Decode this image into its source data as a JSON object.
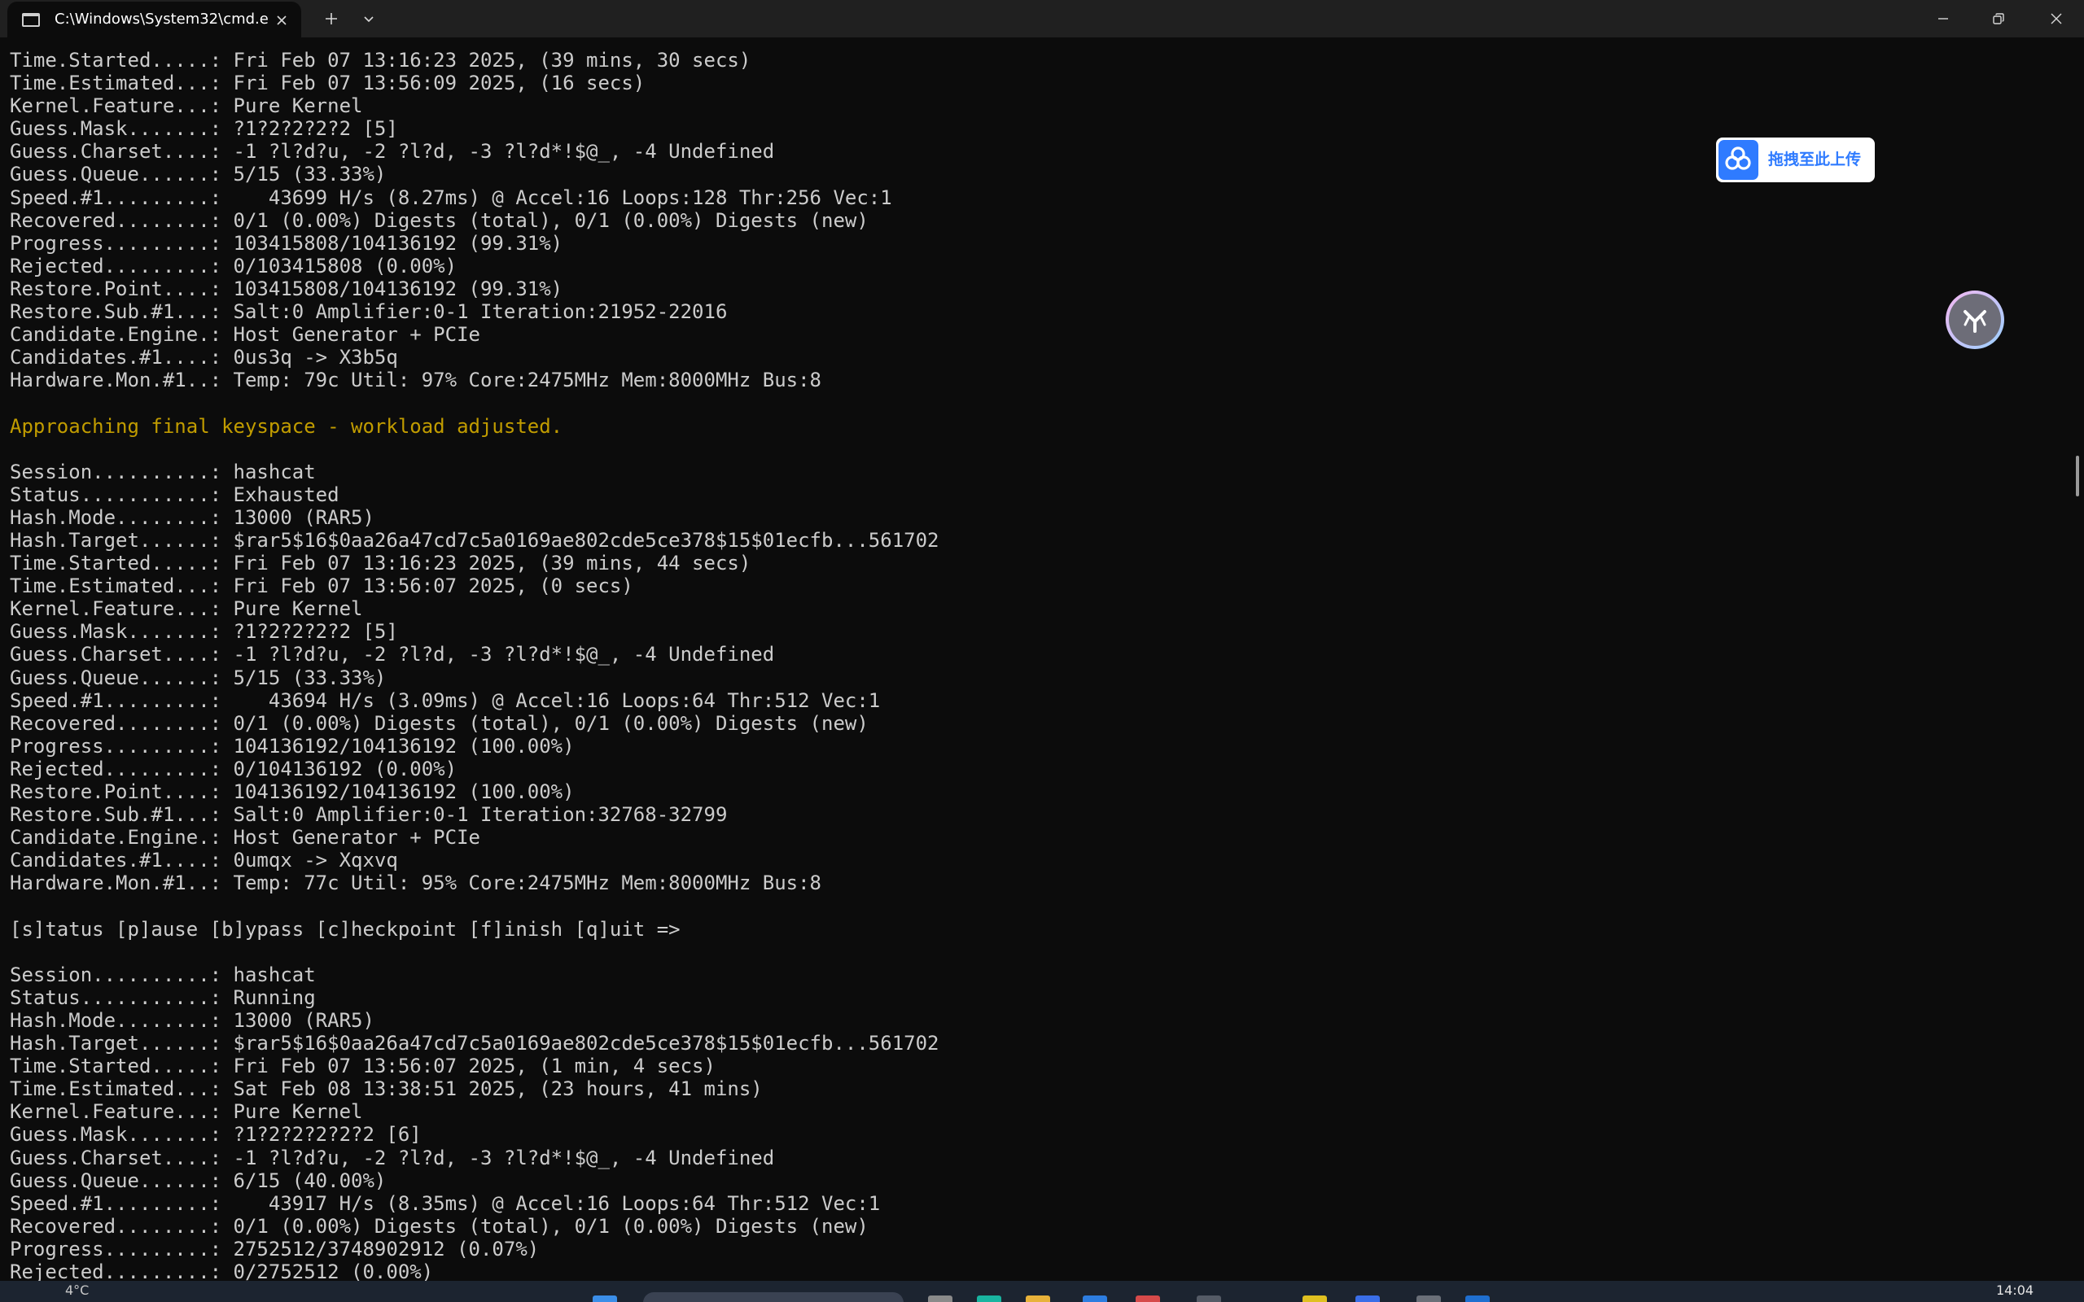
{
  "window": {
    "tab_title": "C:\\Windows\\System32\\cmd.e",
    "icons": {
      "tab": "command-prompt-icon",
      "tab_close": "close-icon",
      "new_tab": "plus-icon",
      "tab_dropdown": "chevron-down-icon",
      "minimize": "minimize-icon",
      "restore": "restore-icon",
      "close": "close-icon"
    }
  },
  "terminal": {
    "colors": {
      "background": "#0c0c0c",
      "text": "#cccccc",
      "warning": "#c19c00"
    },
    "lines": [
      "Time.Started.....: Fri Feb 07 13:16:23 2025, (39 mins, 30 secs)",
      "Time.Estimated...: Fri Feb 07 13:56:09 2025, (16 secs)",
      "Kernel.Feature...: Pure Kernel",
      "Guess.Mask.......: ?1?2?2?2?2 [5]",
      "Guess.Charset....: -1 ?l?d?u, -2 ?l?d, -3 ?l?d*!$@_, -4 Undefined",
      "Guess.Queue......: 5/15 (33.33%)",
      "Speed.#1.........:    43699 H/s (8.27ms) @ Accel:16 Loops:128 Thr:256 Vec:1",
      "Recovered........: 0/1 (0.00%) Digests (total), 0/1 (0.00%) Digests (new)",
      "Progress.........: 103415808/104136192 (99.31%)",
      "Rejected.........: 0/103415808 (0.00%)",
      "Restore.Point....: 103415808/104136192 (99.31%)",
      "Restore.Sub.#1...: Salt:0 Amplifier:0-1 Iteration:21952-22016",
      "Candidate.Engine.: Host Generator + PCIe",
      "Candidates.#1....: 0us3q -> X3b5q",
      "Hardware.Mon.#1..: Temp: 79c Util: 97% Core:2475MHz Mem:8000MHz Bus:8",
      "",
      "Approaching final keyspace - workload adjusted.",
      "",
      "Session..........: hashcat",
      "Status...........: Exhausted",
      "Hash.Mode........: 13000 (RAR5)",
      "Hash.Target......: $rar5$16$0aa26a47cd7c5a0169ae802cde5ce378$15$01ecfb...561702",
      "Time.Started.....: Fri Feb 07 13:16:23 2025, (39 mins, 44 secs)",
      "Time.Estimated...: Fri Feb 07 13:56:07 2025, (0 secs)",
      "Kernel.Feature...: Pure Kernel",
      "Guess.Mask.......: ?1?2?2?2?2 [5]",
      "Guess.Charset....: -1 ?l?d?u, -2 ?l?d, -3 ?l?d*!$@_, -4 Undefined",
      "Guess.Queue......: 5/15 (33.33%)",
      "Speed.#1.........:    43694 H/s (3.09ms) @ Accel:16 Loops:64 Thr:512 Vec:1",
      "Recovered........: 0/1 (0.00%) Digests (total), 0/1 (0.00%) Digests (new)",
      "Progress.........: 104136192/104136192 (100.00%)",
      "Rejected.........: 0/104136192 (0.00%)",
      "Restore.Point....: 104136192/104136192 (100.00%)",
      "Restore.Sub.#1...: Salt:0 Amplifier:0-1 Iteration:32768-32799",
      "Candidate.Engine.: Host Generator + PCIe",
      "Candidates.#1....: 0umqx -> Xqxvq",
      "Hardware.Mon.#1..: Temp: 77c Util: 95% Core:2475MHz Mem:8000MHz Bus:8",
      "",
      "[s]tatus [p]ause [b]ypass [c]heckpoint [f]inish [q]uit =>",
      "",
      "Session..........: hashcat",
      "Status...........: Running",
      "Hash.Mode........: 13000 (RAR5)",
      "Hash.Target......: $rar5$16$0aa26a47cd7c5a0169ae802cde5ce378$15$01ecfb...561702",
      "Time.Started.....: Fri Feb 07 13:56:07 2025, (1 min, 4 secs)",
      "Time.Estimated...: Sat Feb 08 13:38:51 2025, (23 hours, 41 mins)",
      "Kernel.Feature...: Pure Kernel",
      "Guess.Mask.......: ?1?2?2?2?2?2 [6]",
      "Guess.Charset....: -1 ?l?d?u, -2 ?l?d, -3 ?l?d*!$@_, -4 Undefined",
      "Guess.Queue......: 6/15 (40.00%)",
      "Speed.#1.........:    43917 H/s (8.35ms) @ Accel:16 Loops:64 Thr:512 Vec:1",
      "Recovered........: 0/1 (0.00%) Digests (total), 0/1 (0.00%) Digests (new)",
      "Progress.........: 2752512/3748902912 (0.07%)",
      "Rejected.........: 0/2752512 (0.00%)"
    ],
    "warning_line_index": 16
  },
  "overlay": {
    "upload_label": "拖拽至此上传",
    "upload_icon": "baidu-netdisk-icon",
    "assistant_icon": "assistant-logo-icon",
    "upload_color": "#2f7bff"
  },
  "taskbar": {
    "weather": "4°C",
    "clock": "14:04"
  }
}
